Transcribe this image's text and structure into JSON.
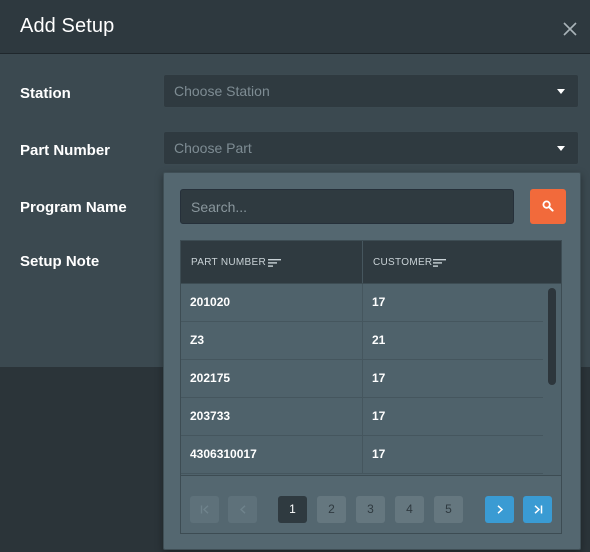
{
  "dialog": {
    "title": "Add Setup"
  },
  "form": {
    "station": {
      "label": "Station",
      "placeholder": "Choose Station"
    },
    "part_number": {
      "label": "Part Number",
      "placeholder": "Choose Part"
    },
    "program_name": {
      "label": "Program Name"
    },
    "setup_note": {
      "label": "Setup Note"
    }
  },
  "dropdown": {
    "search_placeholder": "Search...",
    "columns": [
      "PART NUMBER",
      "CUSTOMER"
    ],
    "rows": [
      {
        "part_number": "201020",
        "customer": "17"
      },
      {
        "part_number": "Z3",
        "customer": "21"
      },
      {
        "part_number": "202175",
        "customer": "17"
      },
      {
        "part_number": "203733",
        "customer": "17"
      },
      {
        "part_number": "4306310017",
        "customer": "17"
      }
    ],
    "pages": [
      "1",
      "2",
      "3",
      "4",
      "5"
    ],
    "current_page": "1"
  },
  "colors": {
    "accent_search": "#f26a3b",
    "accent_nav": "#3a9bd3",
    "panel": "#546770",
    "input_bg": "#2f3a40"
  },
  "icons": {
    "close": "close-icon",
    "caret": "chevron-down-icon",
    "search": "search-icon",
    "sort": "sort-icon",
    "first": "first-page-icon",
    "prev": "previous-page-icon",
    "next": "next-page-icon",
    "last": "last-page-icon"
  }
}
